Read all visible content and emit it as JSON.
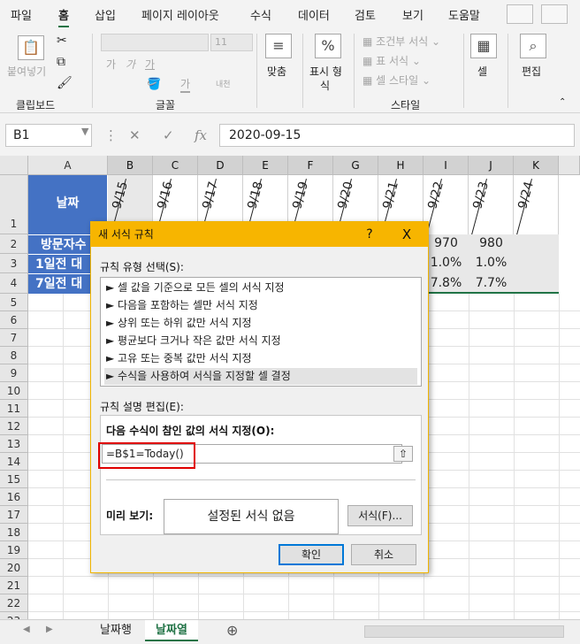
{
  "ribbon": {
    "tabs": [
      "파일",
      "홈",
      "삽입",
      "페이지 레이아웃",
      "수식",
      "데이터",
      "검토",
      "보기",
      "도움말"
    ],
    "clipboard": {
      "paste": "붙여넣기",
      "group": "클립보드"
    },
    "font": {
      "size": "11",
      "group": "글꼴",
      "bold": "가",
      "italic": "가",
      "underline": "가",
      "font_color": "가",
      "phonetic": "내천"
    },
    "alignment": {
      "label": "맞춤"
    },
    "number": {
      "label_line1": "표시 형",
      "label_line2": "식"
    },
    "styles": {
      "conditional": "조건부 서식",
      "table": "표 서식",
      "cell_style": "셀 스타일",
      "group": "스타일"
    },
    "cells": {
      "label": "셀"
    },
    "editing": {
      "label": "편집"
    }
  },
  "formula_bar": {
    "name_box": "B1",
    "formula": "2020-09-15",
    "fx": "fx"
  },
  "grid": {
    "columns": [
      "A",
      "B",
      "C",
      "D",
      "E",
      "F",
      "G",
      "H",
      "I",
      "J",
      "K"
    ],
    "rows": [
      "1",
      "2",
      "3",
      "4",
      "5",
      "6",
      "7",
      "8",
      "9",
      "10",
      "11",
      "12",
      "13",
      "14",
      "15",
      "16",
      "17",
      "18",
      "19",
      "20",
      "21",
      "22",
      "23",
      "24"
    ],
    "header_label": "날짜",
    "row_labels": [
      "방문자수",
      "1일전 대",
      "7일전 대"
    ],
    "dates": [
      "9/15",
      "9/16",
      "9/17",
      "9/18",
      "9/19",
      "9/20",
      "9/21",
      "9/22",
      "9/23",
      "9/24"
    ],
    "visible_values": {
      "i2": "970",
      "j2": "980",
      "i3": "1.0%",
      "j3": "1.0%",
      "i4": "7.8%",
      "j4": "7.7%"
    }
  },
  "sheets": {
    "tabs": [
      "날짜행",
      "날짜열"
    ],
    "active": "날짜열"
  },
  "dialog": {
    "title": "새 서식 규칙",
    "help": "?",
    "close": "X",
    "rule_type_label": "규칙 유형 선택(S):",
    "rule_types": [
      "► 셀 값을 기준으로 모든 셀의 서식 지정",
      "► 다음을 포함하는 셀만 서식 지정",
      "► 상위 또는 하위 값만 서식 지정",
      "► 평균보다 크거나 작은 값만 서식 지정",
      "► 고유 또는 중복 값만 서식 지정",
      "► 수식을 사용하여 서식을 지정할 셀 결정"
    ],
    "desc_label": "규칙 설명 편집(E):",
    "formula_label": "다음 수식이 참인 값의 서식 지정(O):",
    "formula_value": "=B$1=Today()",
    "preview_label": "미리 보기:",
    "preview_text": "설정된 서식 없음",
    "format_button": "서식(F)...",
    "ok_button": "확인",
    "cancel_button": "취소"
  },
  "colors": {
    "accent": "#217346",
    "header_fill": "#4472c4",
    "dialog_title": "#f7b500",
    "highlight": "#e00000"
  }
}
